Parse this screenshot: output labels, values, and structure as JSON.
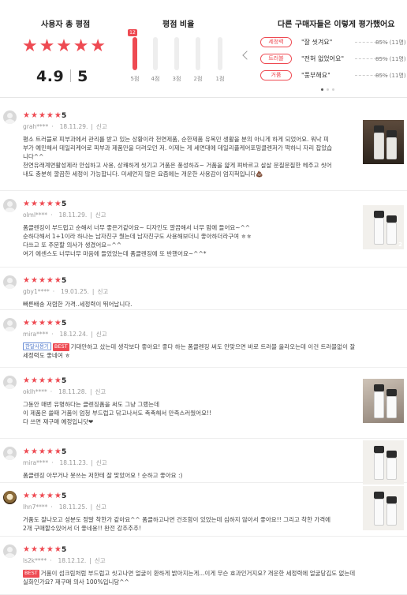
{
  "summary": {
    "avg_title": "사용자 총 평점",
    "avg_score": "4.9",
    "avg_max": "5",
    "avg_stars": 5,
    "dist_title": "평점 비율",
    "distribution": [
      {
        "label": "5점",
        "count": "12",
        "fraction": 1.0
      },
      {
        "label": "4점",
        "count": "",
        "fraction": 0
      },
      {
        "label": "3점",
        "count": "",
        "fraction": 0
      },
      {
        "label": "2점",
        "count": "",
        "fraction": 0
      },
      {
        "label": "1점",
        "count": "",
        "fraction": 0
      }
    ],
    "others_title": "다른 구매자들은 이렇게 평가했어요",
    "keywords": [
      {
        "tag": "세정력",
        "phrase": "\"잘 씻겨요\"",
        "pct": "85% (11명)"
      },
      {
        "tag": "트러블",
        "phrase": "\"전혀 없었어요\"",
        "pct": "85% (11명)"
      },
      {
        "tag": "거품",
        "phrase": "\"풍부해요\"",
        "pct": "85% (11명)"
      }
    ],
    "pager_dots": 3,
    "pager_active": 0
  },
  "colors": {
    "accent": "#ee4a52",
    "badge_month": "#4a74c9"
  },
  "reviews": [
    {
      "user": "grah****",
      "date": "18.11.29.",
      "report": "신고",
      "rating": "5",
      "stars": 5,
      "lines": [
        "평소 트러블로 피부과에서 관리를 받고 있는 상황이라 천연제품, 순한제품 유목민 생활을 분의 아니게 하게 되었어요. 워낙 피",
        "부가 예민해서 데일리케어로 피부과 제품만을 더려오던 저. 이제는 게 세면대에 데일리플케어포밍클렌저가 떡하니 자리 잡았습",
        "니다^^",
        "천연유래계면활성제라 안심하고 사용, 상쾌하게 씻기고 거품은 풍성하죠~ 거품을 얇게 펴바르고 살살 문질문질한 헤주고 씻어",
        "내도 충분히 깔끔한 세정이 가능합니다. 미세먼지 많은 요즘에는 개운한 사용감이 엄지척입니다💩"
      ],
      "badges": [],
      "has_photo": true,
      "photo_count": ""
    },
    {
      "user": "olml****",
      "date": "18.11.29.",
      "report": "신고",
      "rating": "5",
      "stars": 5,
      "lines": [
        "폼클렌징이 부드럽고 순해서 너무 좋은거같아요~ 디자인도 깔끔해서 너무 맘에 들어요~^^",
        "순하다해서 1+1이라 하나는 남자친구 줬는데 남자친구도 사용해보더니 좋아하더라구여 ㅎㅎ",
        "다쓰고 또 주문할 의사가 생겼어요~^^",
        "여기 에센스도 너무너무 마음에 들었었는데 폼클렌징에 또 반했어요~^^*"
      ],
      "badges": [],
      "has_photo": true,
      "photo_count": "2"
    },
    {
      "user": "gby1****",
      "date": "19.01.25.",
      "report": "신고",
      "rating": "5",
      "stars": 5,
      "lines": [
        "빠른배송 저렴한 가격..세정력이 뛰어납니다."
      ],
      "badges": [],
      "has_photo": false,
      "photo_count": ""
    },
    {
      "user": "mira****",
      "date": "18.12.24.",
      "report": "신고",
      "rating": "5",
      "stars": 5,
      "badges": [
        "한달사용기",
        "BEST"
      ],
      "lines": [
        "기대안하고 샀는데 생각보다 좋아요! 좋다 하는 폼클렌징 써도 안맞으면 바로 트러블 올라오는데 이건 트러블없이 잘 쓰고 있고",
        "세정력도 좋네여 ㅎ"
      ],
      "has_photo": false,
      "photo_count": ""
    },
    {
      "user": "oklh****",
      "date": "18.11.28.",
      "report": "신고",
      "rating": "5",
      "stars": 5,
      "lines": [
        "그동안 매번 유명하다는 클렌징폼을 써도 그냥 그랬는데",
        "이 제품은 쓸때 거품이 엄청 부드럽고 닦고나서도 촉촉해서 만족스러웠어요!!",
        "다 쓰면 재구매 예정입니닷❤"
      ],
      "badges": [],
      "has_photo": true,
      "photo_count": ""
    },
    {
      "user": "mira****",
      "date": "18.11.23.",
      "report": "신고",
      "rating": "5",
      "stars": 5,
      "lines": [
        "폼클렌징 아무거나 못쓰는 저한테 잘 맞았어요 ! 순하고 좋아요 :)"
      ],
      "badges": [],
      "has_photo": true,
      "photo_count": ""
    },
    {
      "user": "lhn7****",
      "date": "18.11.25.",
      "report": "신고",
      "rating": "5",
      "stars": 5,
      "lines": [
        "거품도 잘나오고 성분도 정말 착한가 같아요^^ 폼클하고나면 건조함이 있었는데 심하지 않아서 좋아요!! 그리고 착한 가격에",
        "2개 구매할수있어서 더 좋네용!! 완전 강추추추!"
      ],
      "badges": [],
      "has_photo": true,
      "photo_count": ""
    },
    {
      "user": "ls2k****",
      "date": "18.12.12.",
      "report": "신고",
      "rating": "5",
      "stars": 5,
      "badges": [
        "BEST"
      ],
      "lines": [
        "거품이 섬크림처럼 부드럽고 씻고나면 얼굴이 환하게 밝아지는게...이게 무슨 효과인거지요? 개운한 세정력에 얼굴당김도 없는데 이 가격",
        "실화인가요? 재구매 의사 100%입니당^^"
      ],
      "has_photo": false,
      "photo_count": ""
    }
  ]
}
